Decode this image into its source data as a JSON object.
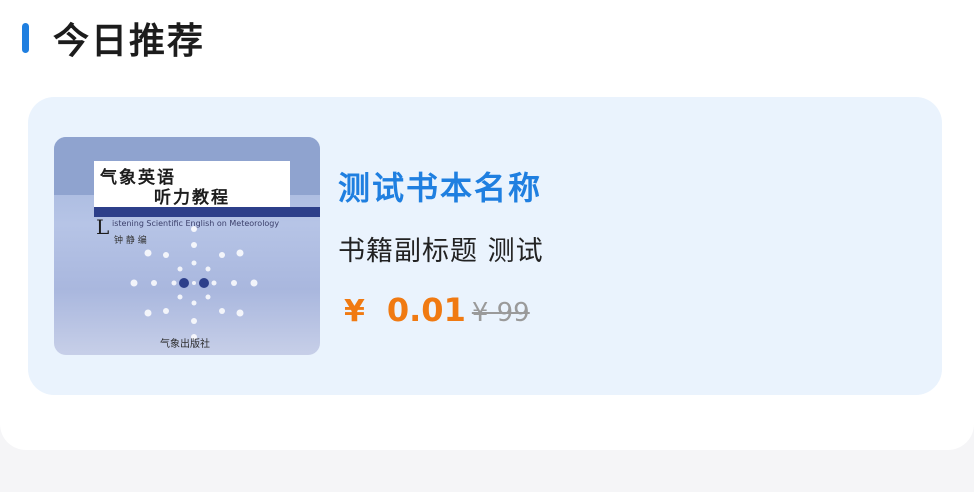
{
  "section": {
    "title": "今日推荐"
  },
  "book": {
    "title": "测试书本名称",
    "subtitle": "书籍副标题 测试",
    "price": {
      "symbol": "¥",
      "value": "0.01",
      "original": "¥ 99"
    },
    "cover": {
      "title_line1": "气象英语",
      "title_line2": "听力教程",
      "letter": "L",
      "english": "istening Scientific English on Meteorology",
      "author": "钟  静  编",
      "publisher": "气象出版社"
    }
  },
  "colors": {
    "accent": "#1f7fe0",
    "price": "#f07a12",
    "card_bg": "#eaf3fd"
  }
}
